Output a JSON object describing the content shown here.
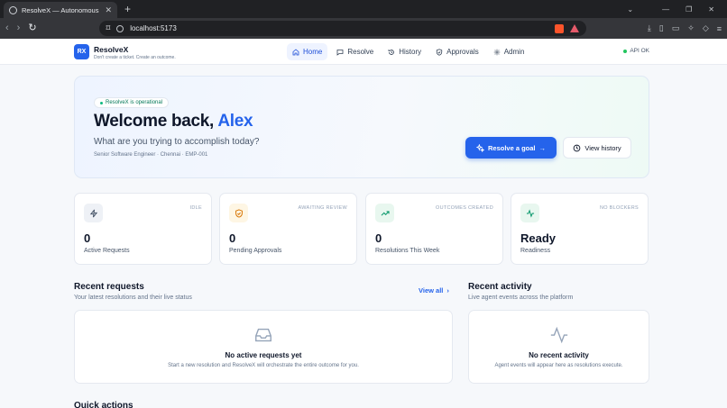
{
  "browser": {
    "tab_title": "ResolveX — Autonomous Emplo...",
    "url": "localhost:5173"
  },
  "header": {
    "logo": "RX",
    "brand_name": "ResolveX",
    "brand_tagline": "Don't create a ticket. Create an outcome.",
    "nav": {
      "home": "Home",
      "resolve": "Resolve",
      "history": "History",
      "approvals": "Approvals",
      "admin": "Admin"
    },
    "api_status": "API OK"
  },
  "hero": {
    "status_pill": "ResolveX is operational",
    "welcome_prefix": "Welcome back,",
    "user_name": "Alex",
    "subtitle": "What are you trying to accomplish today?",
    "meta": "Senior Software Engineer · Chennai · EMP-001",
    "primary_button": "Resolve a goal",
    "secondary_button": "View history"
  },
  "stats": {
    "active": {
      "badge": "IDLE",
      "value": "0",
      "label": "Active Requests"
    },
    "pending": {
      "badge": "AWAITING REVIEW",
      "value": "0",
      "label": "Pending Approvals"
    },
    "resolutions": {
      "badge": "OUTCOMES CREATED",
      "value": "0",
      "label": "Resolutions This Week"
    },
    "readiness": {
      "badge": "NO BLOCKERS",
      "value": "Ready",
      "label": "Readiness"
    }
  },
  "recent_requests": {
    "title": "Recent requests",
    "subtitle": "Your latest resolutions and their live status",
    "view_all": "View all",
    "empty_title": "No active requests yet",
    "empty_desc": "Start a new resolution and ResolveX will orchestrate the entire outcome for you."
  },
  "recent_activity": {
    "title": "Recent activity",
    "subtitle": "Live agent events across the platform",
    "empty_title": "No recent activity",
    "empty_desc": "Agent events will appear here as resolutions execute."
  },
  "quick_actions": {
    "title": "Quick actions"
  },
  "colors": {
    "accent": "#2563eb",
    "success": "#22c55e",
    "warning": "#f59e0b",
    "active_nav_bg": "#eef3ff"
  }
}
